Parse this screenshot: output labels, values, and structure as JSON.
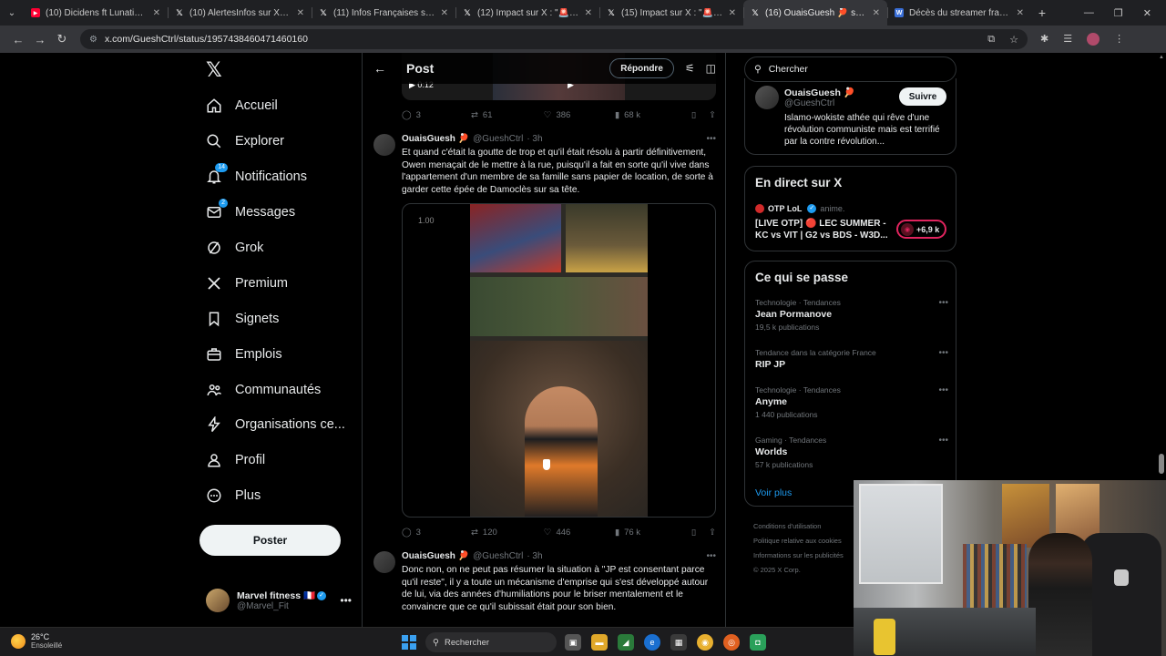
{
  "browser": {
    "tabs": [
      {
        "title": "(10) Dicidens ft Lunatic - De la...",
        "icon": "youtube-icon",
        "active": false
      },
      {
        "title": "(10) AlertesInfos sur X : \"🚨FR...",
        "icon": "x-icon",
        "active": false
      },
      {
        "title": "(11) Infos Françaises sur X : \"DI...",
        "icon": "x-icon",
        "active": false
      },
      {
        "title": "(12) Impact sur X : \"🚨FR AL...",
        "icon": "x-icon",
        "active": false
      },
      {
        "title": "(15) Impact sur X : \"🚨FR ALERT...",
        "icon": "x-icon",
        "active": false
      },
      {
        "title": "(16) OuaisGuesh 🏓 sur X : \"...",
        "icon": "x-icon",
        "active": true
      },
      {
        "title": "Décès du streamer français « Je...",
        "icon": "wikipedia-icon",
        "active": false
      }
    ],
    "url": "x.com/GueshCtrl/status/1957438460471460160"
  },
  "nav": {
    "logo": "𝕏",
    "items": [
      {
        "label": "Accueil",
        "icon": "home-icon",
        "badge": ""
      },
      {
        "label": "Explorer",
        "icon": "search-icon",
        "badge": ""
      },
      {
        "label": "Notifications",
        "icon": "bell-icon",
        "badge": "14"
      },
      {
        "label": "Messages",
        "icon": "mail-icon",
        "badge": "2"
      },
      {
        "label": "Grok",
        "icon": "grok-icon",
        "badge": ""
      },
      {
        "label": "Premium",
        "icon": "x-premium-icon",
        "badge": ""
      },
      {
        "label": "Signets",
        "icon": "bookmark-icon",
        "badge": ""
      },
      {
        "label": "Emplois",
        "icon": "briefcase-icon",
        "badge": ""
      },
      {
        "label": "Communautés",
        "icon": "people-icon",
        "badge": ""
      },
      {
        "label": "Organisations ce...",
        "icon": "lightning-icon",
        "badge": ""
      },
      {
        "label": "Profil",
        "icon": "person-icon",
        "badge": ""
      },
      {
        "label": "Plus",
        "icon": "more-circle-icon",
        "badge": ""
      }
    ],
    "post_button": "Poster",
    "account": {
      "name": "Marvel fitness 🇫🇷",
      "handle": "@Marvel_Fit"
    }
  },
  "header": {
    "title": "Post",
    "reply_button": "Répondre"
  },
  "top_media": {
    "time": "0:12"
  },
  "tweets": [
    {
      "stats": {
        "replies": "3",
        "reposts": "61",
        "likes": "386",
        "views": "68 k"
      }
    },
    {
      "name": "OuaisGuesh 🏓",
      "handle": "@GueshCtrl",
      "time": "· 3h",
      "text": "Et quand c'était la goutte de trop et qu'il était résolu à partir définitivement, Owen menaçait de le mettre à la rue, puisqu'il a fait en sorte qu'il vive dans l'appartement d'un membre de sa famille sans papier de location, de sorte à garder cette épée de Damoclès sur sa tête.",
      "video_speed": "1.00",
      "stats": {
        "replies": "3",
        "reposts": "120",
        "likes": "446",
        "views": "76 k"
      }
    },
    {
      "name": "OuaisGuesh 🏓",
      "handle": "@GueshCtrl",
      "time": "· 3h",
      "text": "Donc non, on ne peut pas résumer la situation à \"JP est consentant parce qu'il reste\", il y a toute un mécanisme d'emprise qui s'est développé autour de lui, via des années d'humiliations pour le briser mentalement et le convaincre que ce qu'il subissait était pour son bien."
    }
  ],
  "right": {
    "search_placeholder": "Chercher",
    "profile": {
      "name": "OuaisGuesh 🏓",
      "handle": "@GueshCtrl",
      "follow": "Suivre",
      "bio": "Islamo-wokiste athée qui rêve d'une révolution communiste mais est terrifié par la contre révolution..."
    },
    "live": {
      "title": "En direct sur X",
      "source": "OTP LoL",
      "source_handle": "anime.",
      "text": "[LIVE OTP] 🔴 LEC SUMMER - KC vs VIT | G2 vs BDS - W3D...",
      "viewers": "+6,9 k"
    },
    "trends": {
      "title": "Ce qui se passe",
      "items": [
        {
          "category": "Technologie · Tendances",
          "topic": "Jean Pormanove",
          "count": "19,5 k publications"
        },
        {
          "category": "Tendance dans la catégorie France",
          "topic": "RIP JP",
          "count": ""
        },
        {
          "category": "Technologie · Tendances",
          "topic": "Anyme",
          "count": "1 440 publications"
        },
        {
          "category": "Gaming · Tendances",
          "topic": "Worlds",
          "count": "57 k publications"
        }
      ],
      "see_more": "Voir plus"
    },
    "footer": [
      "Conditions d'utilisation",
      "Politique relative aux cookies",
      "Informations sur les publicités",
      "© 2025 X Corp."
    ]
  },
  "taskbar": {
    "temperature": "26°C",
    "condition": "Ensoleillé",
    "search": "Rechercher"
  }
}
